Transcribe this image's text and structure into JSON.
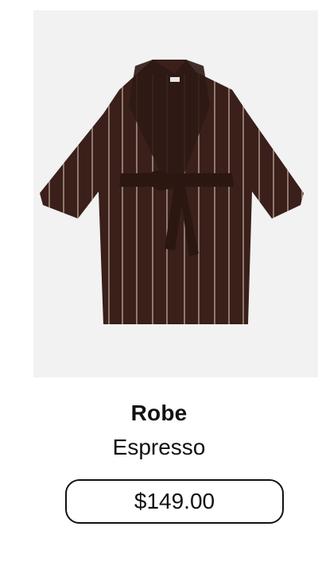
{
  "product": {
    "name": "Robe",
    "color": "Espresso",
    "price": "$149.00",
    "image_icon": "robe-image",
    "colors": {
      "image_bg": "#f2f2f2",
      "robe": "#3a1f1a",
      "stripe": "#c9b8a4"
    }
  }
}
